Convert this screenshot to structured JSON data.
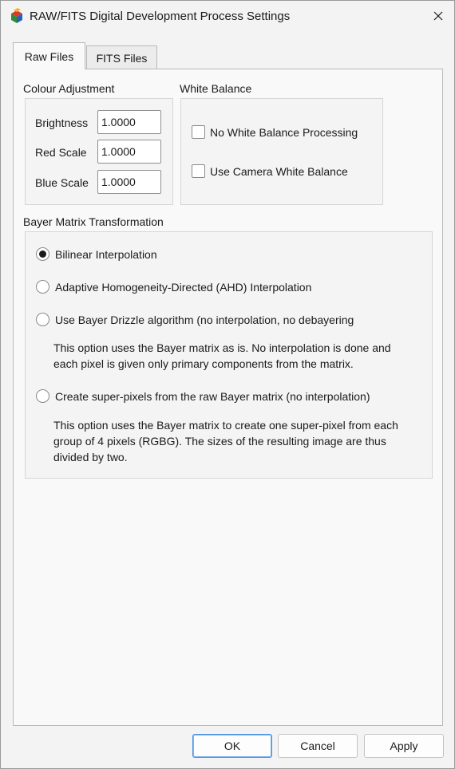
{
  "window": {
    "title": "RAW/FITS Digital Development Process Settings"
  },
  "tabs": [
    {
      "label": "Raw Files",
      "selected": true
    },
    {
      "label": "FITS Files",
      "selected": false
    }
  ],
  "colour_adjustment": {
    "title": "Colour Adjustment",
    "brightness_label": "Brightness",
    "brightness_value": "1.0000",
    "red_label": "Red Scale",
    "red_value": "1.0000",
    "blue_label": "Blue Scale",
    "blue_value": "1.0000"
  },
  "white_balance": {
    "title": "White Balance",
    "no_wb_label": "No White Balance Processing",
    "no_wb_checked": false,
    "camera_wb_label": "Use Camera White Balance",
    "camera_wb_checked": false
  },
  "bayer": {
    "title": "Bayer Matrix Transformation",
    "options": [
      {
        "label": "Bilinear Interpolation",
        "selected": true
      },
      {
        "label": "Adaptive Homogeneity-Directed (AHD) Interpolation",
        "selected": false
      },
      {
        "label": "Use Bayer Drizzle algorithm (no interpolation, no debayering",
        "selected": false
      },
      {
        "label": "Create super-pixels from the raw Bayer matrix (no interpolation)",
        "selected": false
      }
    ],
    "drizzle_desc_1": "This option uses the Bayer matrix as is. No interpolation is done and",
    "drizzle_desc_2": "each pixel is given only primary components from the matrix.",
    "superpixel_desc_1": "This option uses the Bayer matrix to create one super-pixel from each",
    "superpixel_desc_2": "group of 4 pixels (RGBG). The sizes of the resulting image are thus",
    "superpixel_desc_3": "divided by two."
  },
  "buttons": {
    "ok": "OK",
    "cancel": "Cancel",
    "apply": "Apply"
  },
  "icons": {
    "app": "deepskystacker-app-icon",
    "close": "close-icon"
  },
  "colors": {
    "accent": "#4a90e2",
    "window_bg": "#f3f3f3",
    "panel_bg": "#f9f9f9"
  }
}
